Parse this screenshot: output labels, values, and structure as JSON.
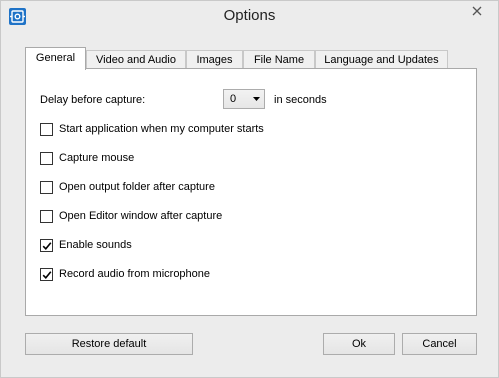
{
  "window": {
    "title": "Options",
    "app_icon": "app-camera-icon",
    "close_icon": "close-icon"
  },
  "tabs": [
    {
      "label": "General",
      "active": true
    },
    {
      "label": "Video and Audio",
      "active": false
    },
    {
      "label": "Images",
      "active": false
    },
    {
      "label": "File Name",
      "active": false
    },
    {
      "label": "Language and Updates",
      "active": false
    }
  ],
  "general": {
    "delay_label": "Delay before capture:",
    "delay_value": "0",
    "delay_unit": "in seconds",
    "options": [
      {
        "label": "Start application when my computer starts",
        "checked": false
      },
      {
        "label": "Capture mouse",
        "checked": false
      },
      {
        "label": "Open output folder after capture",
        "checked": false
      },
      {
        "label": "Open Editor window after capture",
        "checked": false
      },
      {
        "label": "Enable sounds",
        "checked": true
      },
      {
        "label": "Record audio from microphone",
        "checked": true
      }
    ]
  },
  "buttons": {
    "restore": "Restore default",
    "ok": "Ok",
    "cancel": "Cancel"
  }
}
